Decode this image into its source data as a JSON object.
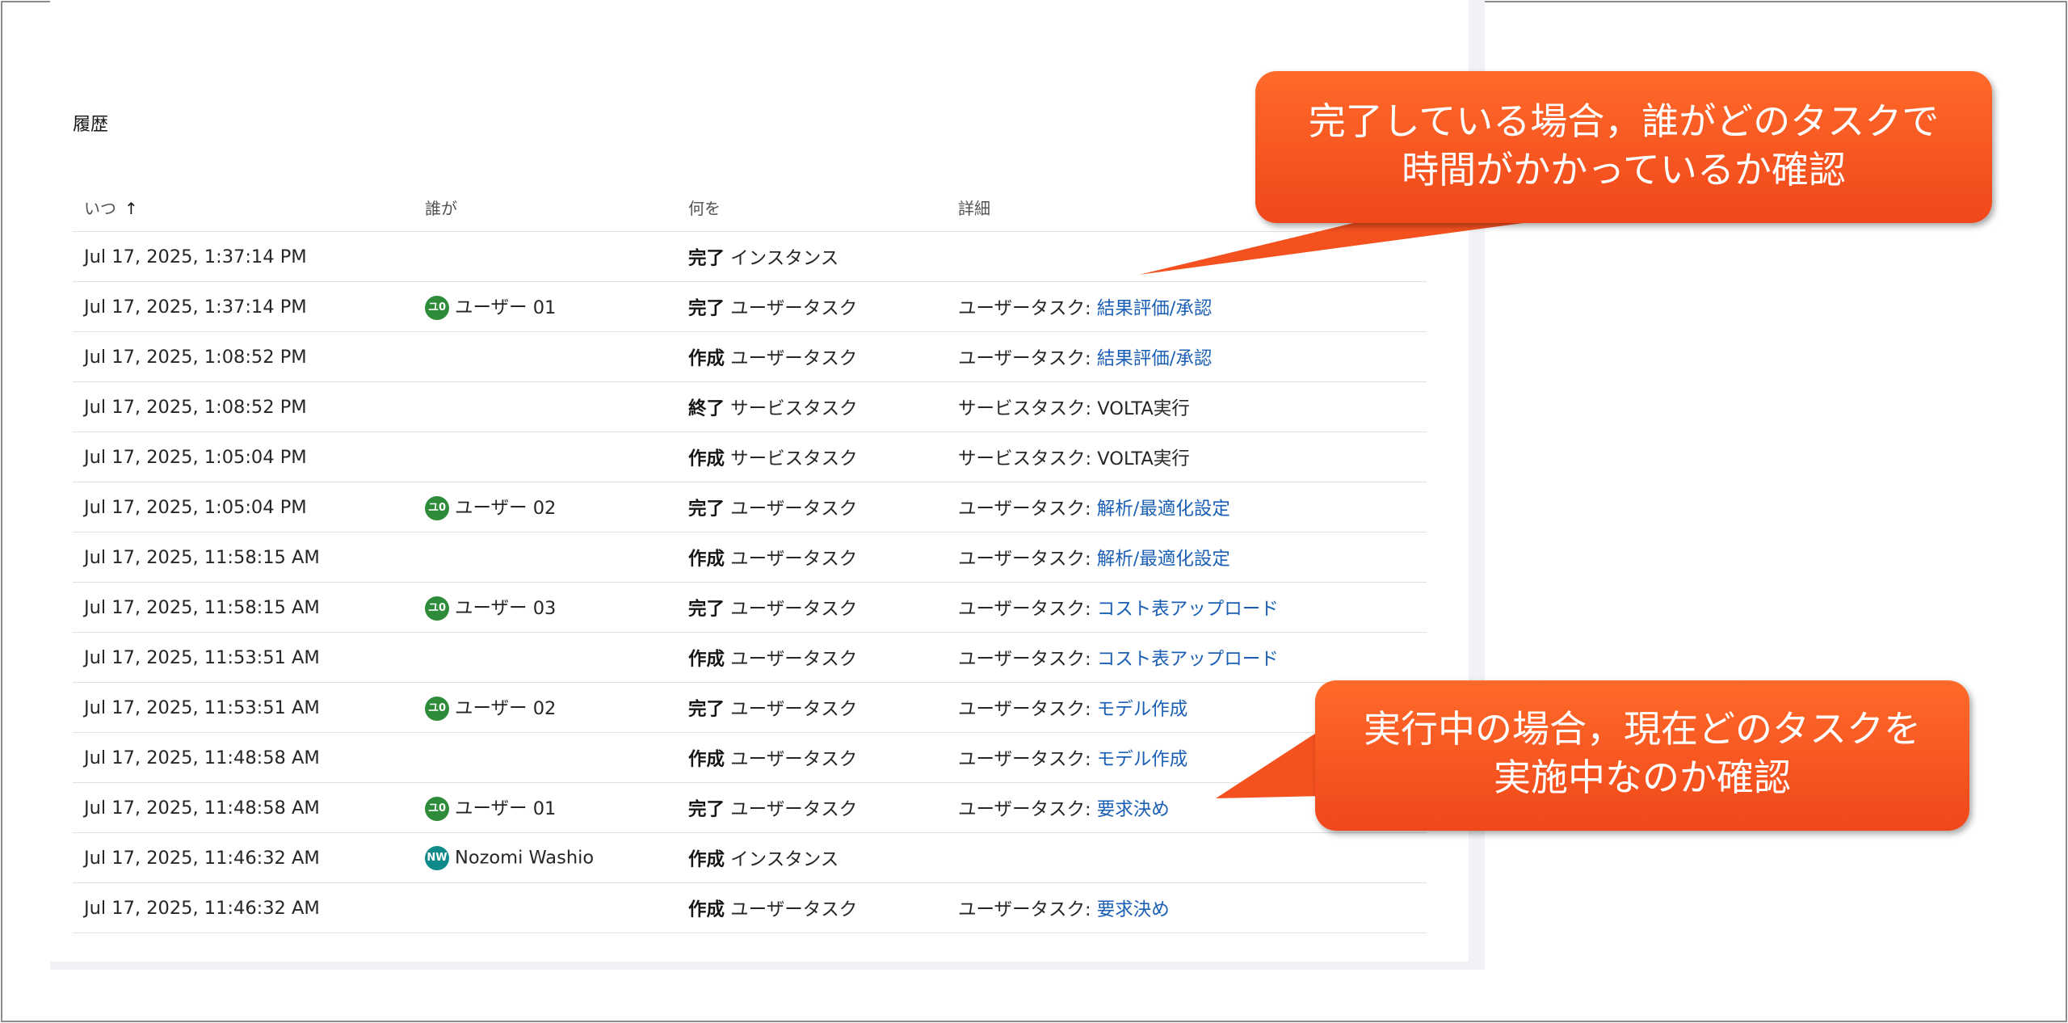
{
  "section_title": "履歴",
  "columns": {
    "when": "いつ",
    "who": "誰が",
    "what": "何を",
    "detail": "詳細"
  },
  "rows": [
    {
      "when": "Jul 17, 2025, 1:37:14 PM",
      "who_initials": "",
      "who_name": "",
      "verb": "完了",
      "object": "インスタンス",
      "detail_prefix": "",
      "detail_link": "",
      "detail_text": ""
    },
    {
      "when": "Jul 17, 2025, 1:37:14 PM",
      "who_initials": "ユ0",
      "who_name": "ユーザー 01",
      "verb": "完了",
      "object": "ユーザータスク",
      "detail_prefix": "ユーザータスク: ",
      "detail_link": "結果評価/承認",
      "detail_text": ""
    },
    {
      "when": "Jul 17, 2025, 1:08:52 PM",
      "who_initials": "",
      "who_name": "",
      "verb": "作成",
      "object": "ユーザータスク",
      "detail_prefix": "ユーザータスク: ",
      "detail_link": "結果評価/承認",
      "detail_text": ""
    },
    {
      "when": "Jul 17, 2025, 1:08:52 PM",
      "who_initials": "",
      "who_name": "",
      "verb": "終了",
      "object": "サービスタスク",
      "detail_prefix": "サービスタスク: ",
      "detail_link": "",
      "detail_text": "VOLTA実行"
    },
    {
      "when": "Jul 17, 2025, 1:05:04 PM",
      "who_initials": "",
      "who_name": "",
      "verb": "作成",
      "object": "サービスタスク",
      "detail_prefix": "サービスタスク: ",
      "detail_link": "",
      "detail_text": "VOLTA実行"
    },
    {
      "when": "Jul 17, 2025, 1:05:04 PM",
      "who_initials": "ユ0",
      "who_name": "ユーザー 02",
      "verb": "完了",
      "object": "ユーザータスク",
      "detail_prefix": "ユーザータスク: ",
      "detail_link": "解析/最適化設定",
      "detail_text": ""
    },
    {
      "when": "Jul 17, 2025, 11:58:15 AM",
      "who_initials": "",
      "who_name": "",
      "verb": "作成",
      "object": "ユーザータスク",
      "detail_prefix": "ユーザータスク: ",
      "detail_link": "解析/最適化設定",
      "detail_text": ""
    },
    {
      "when": "Jul 17, 2025, 11:58:15 AM",
      "who_initials": "ユ0",
      "who_name": "ユーザー 03",
      "verb": "完了",
      "object": "ユーザータスク",
      "detail_prefix": "ユーザータスク: ",
      "detail_link": "コスト表アップロード",
      "detail_text": ""
    },
    {
      "when": "Jul 17, 2025, 11:53:51 AM",
      "who_initials": "",
      "who_name": "",
      "verb": "作成",
      "object": "ユーザータスク",
      "detail_prefix": "ユーザータスク: ",
      "detail_link": "コスト表アップロード",
      "detail_text": ""
    },
    {
      "when": "Jul 17, 2025, 11:53:51 AM",
      "who_initials": "ユ0",
      "who_name": "ユーザー 02",
      "verb": "完了",
      "object": "ユーザータスク",
      "detail_prefix": "ユーザータスク: ",
      "detail_link": "モデル作成",
      "detail_text": ""
    },
    {
      "when": "Jul 17, 2025, 11:48:58 AM",
      "who_initials": "",
      "who_name": "",
      "verb": "作成",
      "object": "ユーザータスク",
      "detail_prefix": "ユーザータスク: ",
      "detail_link": "モデル作成",
      "detail_text": ""
    },
    {
      "when": "Jul 17, 2025, 11:48:58 AM",
      "who_initials": "ユ0",
      "who_name": "ユーザー 01",
      "verb": "完了",
      "object": "ユーザータスク",
      "detail_prefix": "ユーザータスク: ",
      "detail_link": "要求決め",
      "detail_text": ""
    },
    {
      "when": "Jul 17, 2025, 11:46:32 AM",
      "who_initials": "NW",
      "who_name": "Nozomi Washio",
      "verb": "作成",
      "object": "インスタンス",
      "detail_prefix": "",
      "detail_link": "",
      "detail_text": ""
    },
    {
      "when": "Jul 17, 2025, 11:46:32 AM",
      "who_initials": "",
      "who_name": "",
      "verb": "作成",
      "object": "ユーザータスク",
      "detail_prefix": "ユーザータスク: ",
      "detail_link": "要求決め",
      "detail_text": ""
    }
  ],
  "callouts": {
    "completed_line1": "完了している場合，誰がどのタスクで",
    "completed_line2": "時間がかかっているか確認",
    "running_line1": "実行中の場合，現在どのタスクを",
    "running_line2": "実施中なのか確認"
  },
  "colors": {
    "avatar_user": "#2e8b3a",
    "avatar_nw": "#0f8a8a",
    "link": "#1a5fb4",
    "callout": "#f4511e"
  }
}
